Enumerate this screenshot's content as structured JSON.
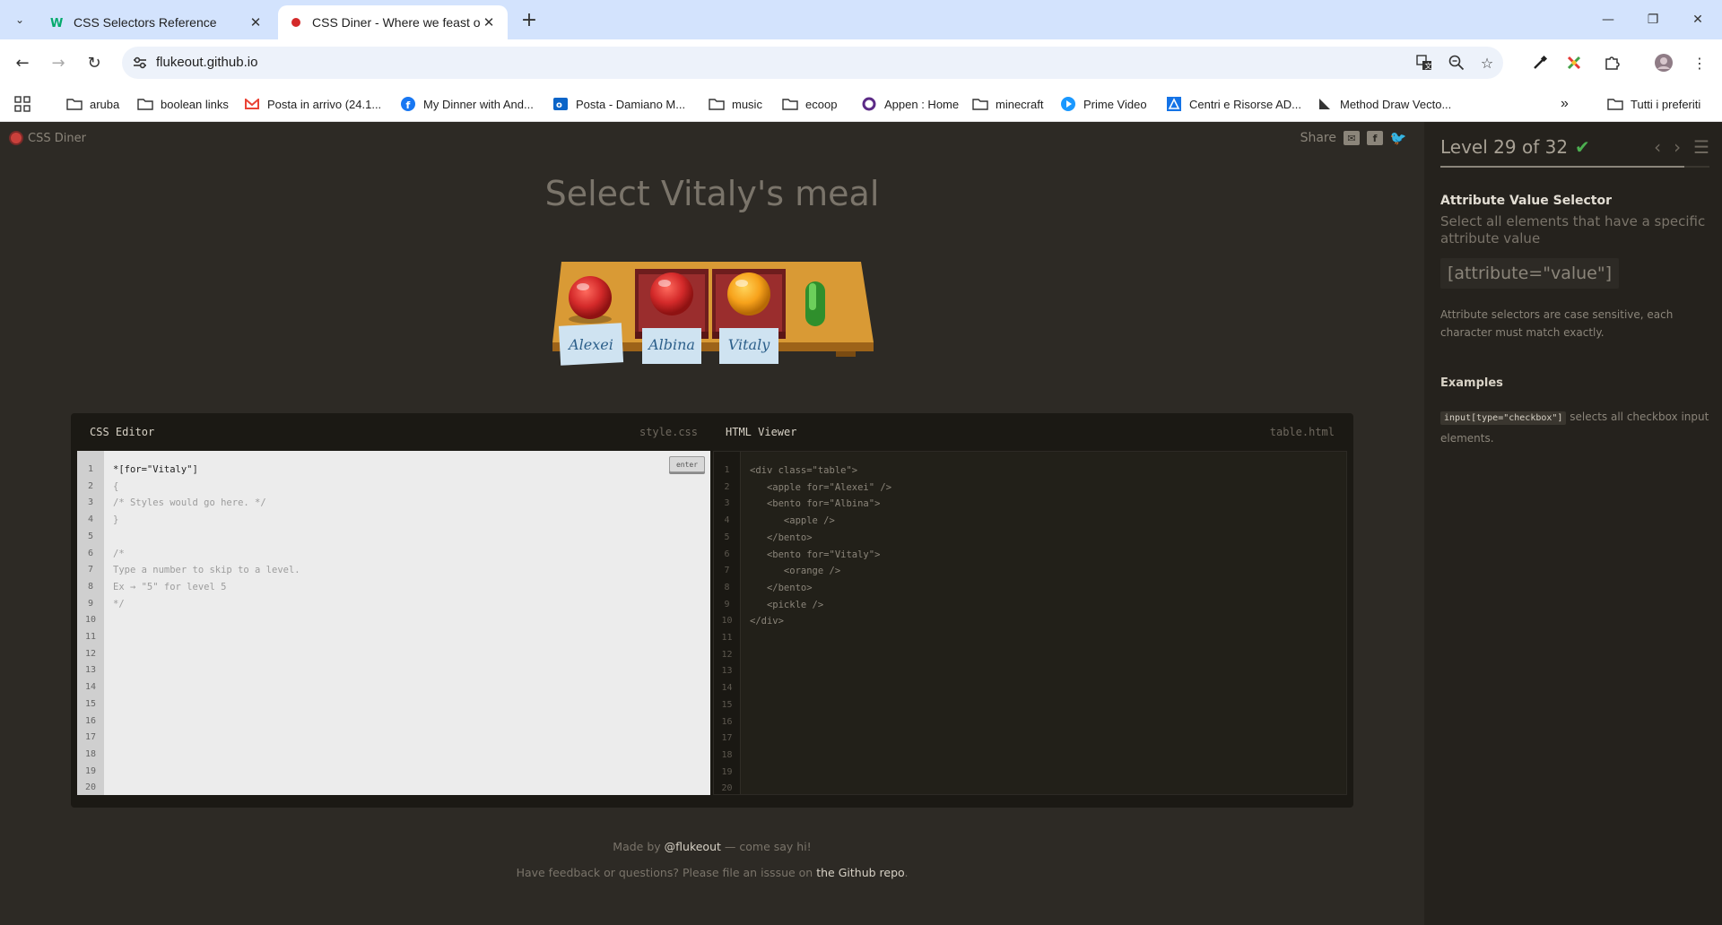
{
  "browser": {
    "tabs": [
      {
        "title": "CSS Selectors Reference",
        "favicon": "w3schools-icon",
        "active": false
      },
      {
        "title": "CSS Diner - Where we feast on",
        "favicon": "css-diner-icon",
        "active": true
      }
    ],
    "url": "flukeout.github.io",
    "bookmarks": [
      {
        "label": "aruba",
        "icon": "folder-icon"
      },
      {
        "label": "boolean links",
        "icon": "folder-icon"
      },
      {
        "label": "Posta in arrivo (24.1...",
        "icon": "gmail-icon"
      },
      {
        "label": "My Dinner with And...",
        "icon": "facebook-icon"
      },
      {
        "label": "Posta - Damiano M...",
        "icon": "outlook-icon"
      },
      {
        "label": "music",
        "icon": "folder-icon"
      },
      {
        "label": "ecoop",
        "icon": "folder-icon"
      },
      {
        "label": "Appen : Home",
        "icon": "appen-icon"
      },
      {
        "label": "minecraft",
        "icon": "folder-icon"
      },
      {
        "label": "Prime Video",
        "icon": "prime-video-icon"
      },
      {
        "label": "Centri e Risorse AD...",
        "icon": "adobe-icon"
      },
      {
        "label": "Method Draw Vecto...",
        "icon": "method-draw-icon"
      }
    ],
    "all_bookmarks_label": "Tutti i preferiti"
  },
  "game": {
    "logo_text": "CSS Diner",
    "share_label": "Share",
    "order": "Select Vitaly's meal",
    "plates": [
      {
        "name": "Alexei",
        "item": "apple",
        "bento": false
      },
      {
        "name": "Albina",
        "item": "apple",
        "bento": true
      },
      {
        "name": "Vitaly",
        "item": "orange",
        "bento": true
      },
      {
        "name": "",
        "item": "pickle",
        "bento": false
      }
    ]
  },
  "editor": {
    "css_title": "CSS Editor",
    "css_file": "style.css",
    "html_title": "HTML Viewer",
    "html_file": "table.html",
    "enter_label": "enter",
    "input_value": "*[for=\"Vitaly\"]",
    "css_lines": [
      "{",
      "/* Styles would go here. */",
      "}",
      "",
      "/*",
      "Type a number to skip to a level.",
      "Ex → \"5\" for level 5",
      "*/"
    ],
    "html_lines": [
      "<div class=\"table\">",
      "   <apple for=\"Alexei\" />",
      "   <bento for=\"Albina\">",
      "      <apple />",
      "   </bento>",
      "   <bento for=\"Vitaly\">",
      "      <orange />",
      "   </bento>",
      "   <pickle />",
      "</div>"
    ],
    "line_count": 20
  },
  "footer": {
    "made_by_prefix": "Made by ",
    "made_by_link": "@flukeout",
    "made_by_suffix": " — come say hi!",
    "feedback_prefix": "Have feedback or questions? Please file an isssue on ",
    "feedback_link": "the Github repo",
    "feedback_suffix": "."
  },
  "sidebar": {
    "level_label": "Level 29 of 32",
    "level_current": 29,
    "level_total": 32,
    "completed": true,
    "selector_name": "Attribute Value Selector",
    "selector_title": "Select all elements that have a specific attribute value",
    "syntax": "[attribute=\"value\"]",
    "hint": "Attribute selectors are case sensitive, each character must match exactly.",
    "examples_title": "Examples",
    "example_code": "input[type=\"checkbox\"]",
    "example_text": " selects all checkbox input elements."
  },
  "colors": {
    "background": "#2d2a25",
    "sidebar": "#25221d",
    "accent_green": "#4caf50",
    "apple_red": "#d42a2a",
    "orange": "#f7a21b",
    "bento_red": "#8e2a2a",
    "table_wood": "#d99a35",
    "pickle_green": "#3fae3a"
  }
}
